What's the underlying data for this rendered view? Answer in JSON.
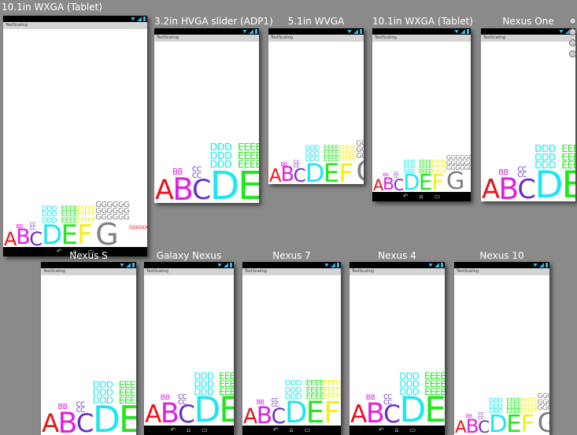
{
  "devices": [
    {
      "name": "10.1in WXGA (Tablet)",
      "app_title": "TestScaling",
      "nav": true
    },
    {
      "name": "3.2in HVGA slider (ADP1)",
      "app_title": "TestScaling",
      "nav": false
    },
    {
      "name": "5.1in WVGA",
      "app_title": "TestScaling",
      "nav": false
    },
    {
      "name": "10.1in WXGA (Tablet)",
      "app_title": "TestScaling",
      "nav": true
    },
    {
      "name": "Nexus One",
      "app_title": "TestScaling",
      "nav": false
    },
    {
      "name": "Nexus S",
      "app_title": "TestScaling",
      "nav": false
    },
    {
      "name": "Galaxy Nexus",
      "app_title": "TestScaling",
      "nav": true
    },
    {
      "name": "Nexus 7",
      "app_title": "TestScaling",
      "nav": true
    },
    {
      "name": "Nexus 4",
      "app_title": "TestScaling",
      "nav": true
    },
    {
      "name": "Nexus 10",
      "app_title": "TestScaling",
      "nav": false
    }
  ],
  "letters": [
    {
      "char": "A",
      "color": "#e8141c"
    },
    {
      "char": "B",
      "color": "#e020e0"
    },
    {
      "char": "C",
      "color": "#6a2cc8"
    },
    {
      "char": "D",
      "color": "#1ee6f0"
    },
    {
      "char": "E",
      "color": "#22e61e"
    },
    {
      "char": "F",
      "color": "#f4f00c"
    },
    {
      "char": "G",
      "color": "#808080"
    },
    {
      "small": "G",
      "small_color": "#e8141c"
    }
  ],
  "nav_icons": [
    "back-icon",
    "home-icon",
    "recents-icon"
  ]
}
